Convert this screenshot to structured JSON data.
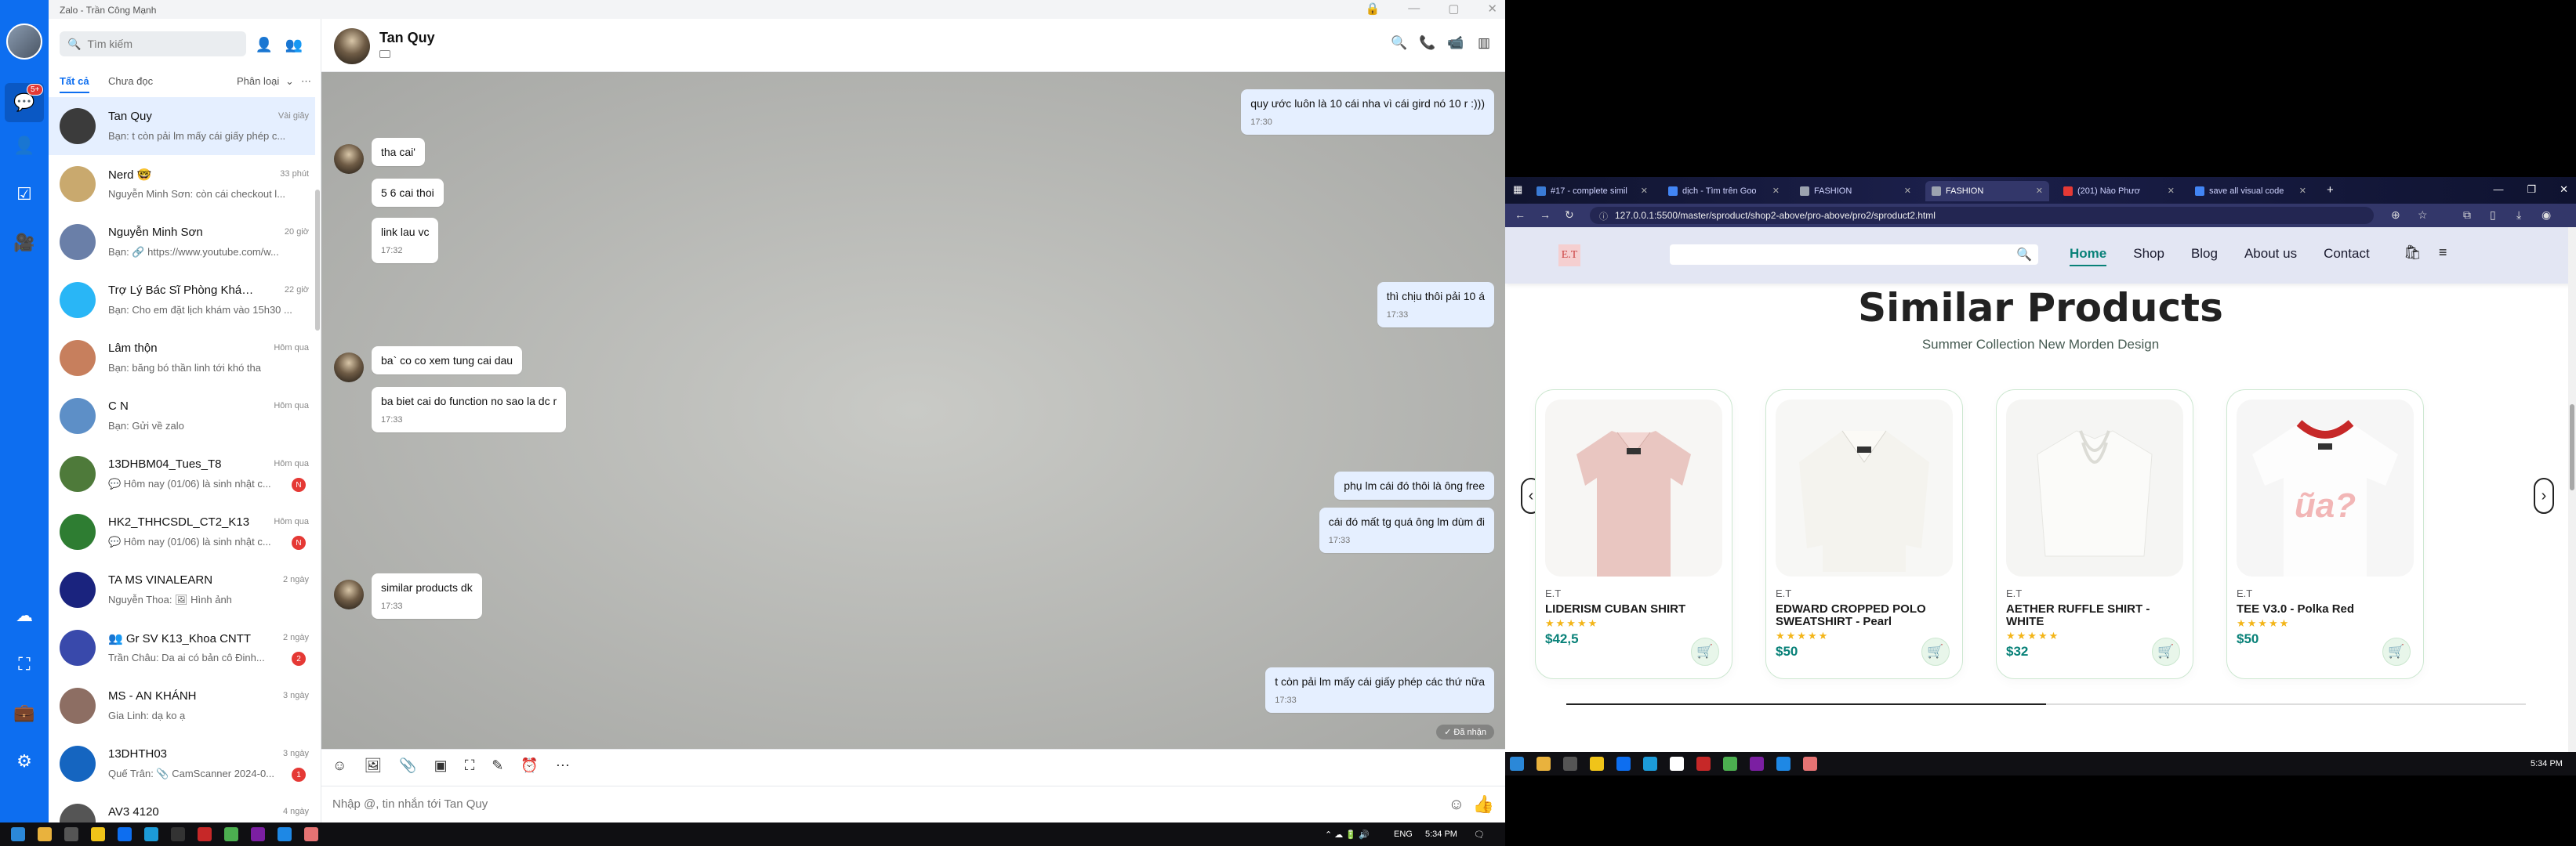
{
  "zalo": {
    "window_title": "Zalo - Trần Công Mạnh",
    "rail": {
      "badge": "5+"
    },
    "search_placeholder": "Tìm kiếm",
    "tabs": {
      "all": "Tất cả",
      "unread": "Chưa đọc",
      "classify": "Phân loại"
    },
    "conversations": [
      {
        "name": "Tan Quy",
        "time": "Vài giây",
        "preview": "Bạn: t còn pải lm mấy cái giấy phép c...",
        "badge": ""
      },
      {
        "name": "Nerd 🤓",
        "time": "33 phút",
        "preview": "Nguyễn Minh Sơn: còn cái checkout l...",
        "badge": ""
      },
      {
        "name": "Nguyễn Minh Sơn",
        "time": "20 giờ",
        "preview": "Bạn: 🔗 https://www.youtube.com/w...",
        "badge": ""
      },
      {
        "name": "Trợ Lý Bác Sĩ Phòng Khám D...",
        "time": "22 giờ",
        "preview": "Bạn: Cho em đặt lịch khám vào 15h30 ...",
        "badge": ""
      },
      {
        "name": "Lâm thộn",
        "time": "Hôm qua",
        "preview": "Bạn: băng bó thần linh tới khó tha",
        "badge": ""
      },
      {
        "name": "C N",
        "time": "Hôm qua",
        "preview": "Bạn: Gửi về zalo",
        "badge": ""
      },
      {
        "name": "13DHBM04_Tues_T8",
        "time": "Hôm qua",
        "preview": "💬 Hôm nay (01/06) là sinh nhật c...",
        "badge": "N"
      },
      {
        "name": "HK2_THHCSDL_CT2_K13",
        "time": "Hôm qua",
        "preview": "💬 Hôm nay (01/06) là sinh nhật c...",
        "badge": "N"
      },
      {
        "name": "TA MS VINALEARN",
        "time": "2 ngày",
        "preview": "Nguyễn Thoa: 🖼 Hình ảnh",
        "badge": ""
      },
      {
        "name": "👥 Gr SV K13_Khoa CNTT",
        "time": "2 ngày",
        "preview": "Trần Châu: Da ai có bản cô Đinh...",
        "badge": "2"
      },
      {
        "name": "MS - AN KHÁNH",
        "time": "3 ngày",
        "preview": "Gia Linh: dạ ko ạ",
        "badge": ""
      },
      {
        "name": "13DHTH03",
        "time": "3 ngày",
        "preview": "Quế Trân: 📎 CamScanner 2024-0...",
        "badge": "1"
      },
      {
        "name": "AV3 4120",
        "time": "4 ngày",
        "preview": "",
        "badge": ""
      }
    ],
    "chat": {
      "contact_name": "Tan Quy",
      "messages": [
        {
          "from": "me",
          "text": "quy ước luôn là 10 cái nha vì cái gird nó 10 r :)))",
          "time": "17:30"
        },
        {
          "from": "them",
          "text": "tha cai'",
          "time": ""
        },
        {
          "from": "them",
          "text": "5 6 cai thoi",
          "time": ""
        },
        {
          "from": "them",
          "text": "link lau vc",
          "time": "17:32"
        },
        {
          "from": "me",
          "text": "thì chịu thôi pải 10 á",
          "time": "17:33"
        },
        {
          "from": "them",
          "text": "ba` co co xem tung cai dau",
          "time": ""
        },
        {
          "from": "them",
          "text": "ba biet cai do function no sao la dc r",
          "time": "17:33"
        },
        {
          "from": "me",
          "text": "phụ lm cái đó thôi là ông free",
          "time": ""
        },
        {
          "from": "me",
          "text": "cái đó mất tg quá ông lm dùm đi",
          "time": "17:33"
        },
        {
          "from": "them",
          "text": "similar products dk",
          "time": "17:33"
        },
        {
          "from": "me",
          "text": "t còn pải lm mấy cái giấy phép các thứ nữa",
          "time": "17:33"
        }
      ],
      "seen_label": "✓ Đã nhận",
      "composer_placeholder": "Nhập @, tin nhắn tới Tan Quy"
    },
    "tray": {
      "lang": "ENG",
      "time": "5:34 PM"
    }
  },
  "browser": {
    "tabs": [
      {
        "label": "#17 - complete simil",
        "color": "#3a7bd5"
      },
      {
        "label": "dịch - Tìm trên Goo",
        "color": "#4285f4"
      },
      {
        "label": "FASHION",
        "color": "#9ca3af"
      },
      {
        "label": "FASHION",
        "color": "#9ca3af"
      },
      {
        "label": "(201) Nào Phươ",
        "color": "#e53935"
      },
      {
        "label": "save all visual code",
        "color": "#4285f4"
      }
    ],
    "url": "127.0.0.1:5500/master/sproduct/shop2-above/pro-above/pro2/sproduct2.html",
    "site": {
      "logo": "E.T",
      "nav": [
        "Home",
        "Shop",
        "Blog",
        "About us",
        "Contact"
      ],
      "section_title": "Similar Products",
      "section_subtitle": "Summer Collection New Morden Design",
      "products": [
        {
          "brand": "E.T",
          "name": "LIDERISM CUBAN SHIRT",
          "price": "$42,5",
          "rating": 5
        },
        {
          "brand": "E.T",
          "name": "EDWARD CROPPED POLO SWEATSHIRT - Pearl",
          "price": "$50",
          "rating": 5
        },
        {
          "brand": "E.T",
          "name": "AETHER RUFFLE SHIRT - WHITE",
          "price": "$32",
          "rating": 5
        },
        {
          "brand": "E.T",
          "name": "TEE V3.0 - Polka Red",
          "price": "$50",
          "rating": 5
        }
      ],
      "carousel_progress": 0.5
    },
    "taskbar_time": "5:34 PM"
  },
  "colors": {
    "zalo_blue": "#0d6ef0",
    "site_green": "#088178",
    "star": "#f3b519"
  }
}
